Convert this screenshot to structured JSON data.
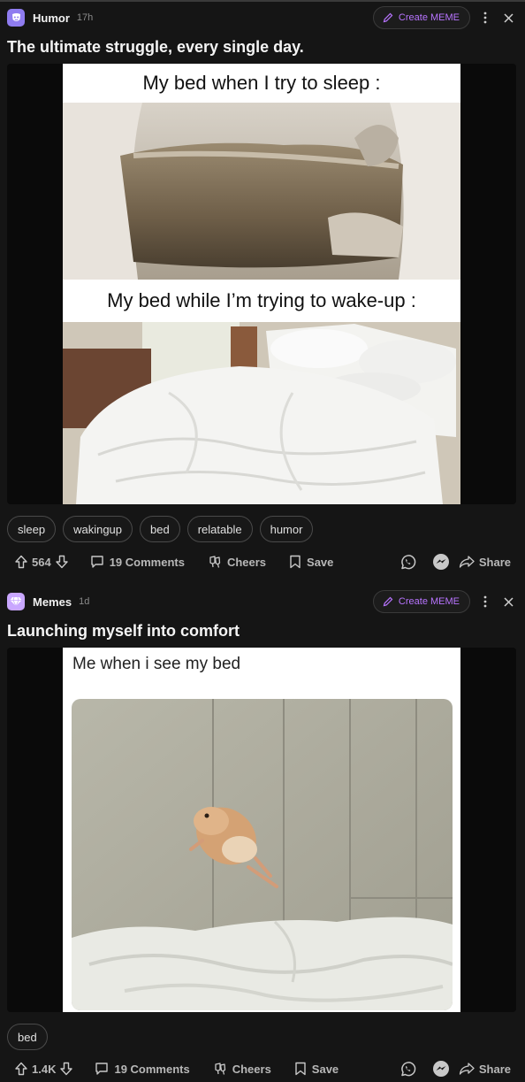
{
  "posts": [
    {
      "category": "Humor",
      "time": "17h",
      "create_label": "Create MEME",
      "title": "The ultimate struggle, every single day.",
      "meme_captions": [
        "My bed when I try to sleep :",
        "My bed while I’m trying to wake-up :"
      ],
      "tags": [
        "sleep",
        "wakingup",
        "bed",
        "relatable",
        "humor"
      ],
      "votes": "564",
      "comments": "19 Comments",
      "cheers": "Cheers",
      "save": "Save",
      "share": "Share"
    },
    {
      "category": "Memes",
      "time": "1d",
      "create_label": "Create MEME",
      "title": "Launching myself into comfort",
      "meme_captions": [
        "Me when i see my bed"
      ],
      "tags": [
        "bed"
      ],
      "votes": "1.4K",
      "comments": "19 Comments",
      "cheers": "Cheers",
      "save": "Save",
      "share": "Share"
    }
  ],
  "colors": {
    "accent": "#b874ff",
    "humor_icon": "#8f7cf0",
    "memes_icon": "#c9a7ff",
    "background": "#151515"
  },
  "icons": [
    "upvote-icon",
    "downvote-icon",
    "comment-icon",
    "cheers-icon",
    "bookmark-icon",
    "whatsapp-icon",
    "messenger-icon",
    "share-arrow-icon",
    "pencil-icon",
    "more-vertical-icon",
    "close-icon"
  ]
}
